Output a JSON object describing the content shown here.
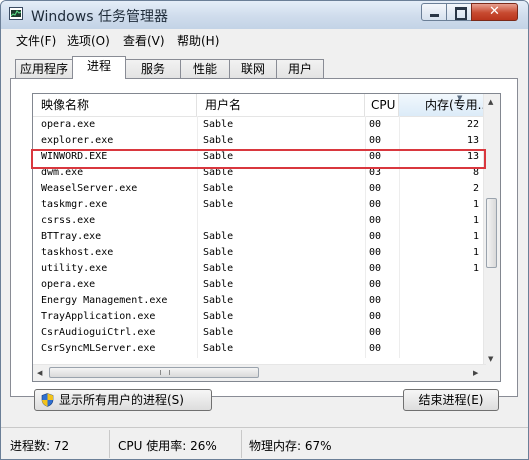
{
  "window": {
    "title": "Windows 任务管理器",
    "minimize_label": "",
    "close_glyph": "✕"
  },
  "menu": [
    "文件(F)",
    "选项(O)",
    "查看(V)",
    "帮助(H)"
  ],
  "tabs": [
    "应用程序",
    "进程",
    "服务",
    "性能",
    "联网",
    "用户"
  ],
  "active_tab": "进程",
  "columns": {
    "name": "映像名称",
    "user": "用户名",
    "cpu": "CPU",
    "mem": "内存(专用..."
  },
  "processes": [
    {
      "name": "opera.exe",
      "user": "Sable",
      "cpu": "00",
      "mem": "22"
    },
    {
      "name": "explorer.exe",
      "user": "Sable",
      "cpu": "00",
      "mem": "13"
    },
    {
      "name": "WINWORD.EXE",
      "user": "Sable",
      "cpu": "00",
      "mem": "13"
    },
    {
      "name": "dwm.exe",
      "user": "Sable",
      "cpu": "03",
      "mem": "8"
    },
    {
      "name": "WeaselServer.exe",
      "user": "Sable",
      "cpu": "00",
      "mem": "2"
    },
    {
      "name": "taskmgr.exe",
      "user": "Sable",
      "cpu": "00",
      "mem": "1"
    },
    {
      "name": "csrss.exe",
      "user": "",
      "cpu": "00",
      "mem": "1"
    },
    {
      "name": "BTTray.exe",
      "user": "Sable",
      "cpu": "00",
      "mem": "1"
    },
    {
      "name": "taskhost.exe",
      "user": "Sable",
      "cpu": "00",
      "mem": "1"
    },
    {
      "name": "utility.exe",
      "user": "Sable",
      "cpu": "00",
      "mem": "1"
    },
    {
      "name": "opera.exe",
      "user": "Sable",
      "cpu": "00",
      "mem": ""
    },
    {
      "name": "Energy Management.exe",
      "user": "Sable",
      "cpu": "00",
      "mem": ""
    },
    {
      "name": "TrayApplication.exe",
      "user": "Sable",
      "cpu": "00",
      "mem": ""
    },
    {
      "name": "CsrAudioguiCtrl.exe",
      "user": "Sable",
      "cpu": "00",
      "mem": ""
    },
    {
      "name": "CsrSyncMLServer.exe",
      "user": "Sable",
      "cpu": "00",
      "mem": ""
    }
  ],
  "highlighted_process": "WINWORD.EXE",
  "buttons": {
    "show_all": "显示所有用户的进程(S)",
    "end_process": "结束进程(E)"
  },
  "status": {
    "processes": "进程数: 72",
    "cpu": "CPU 使用率: 26%",
    "memory": "物理内存: 67%"
  },
  "colors": {
    "highlight_border": "#d9373e",
    "close_button": "#c74a30"
  }
}
